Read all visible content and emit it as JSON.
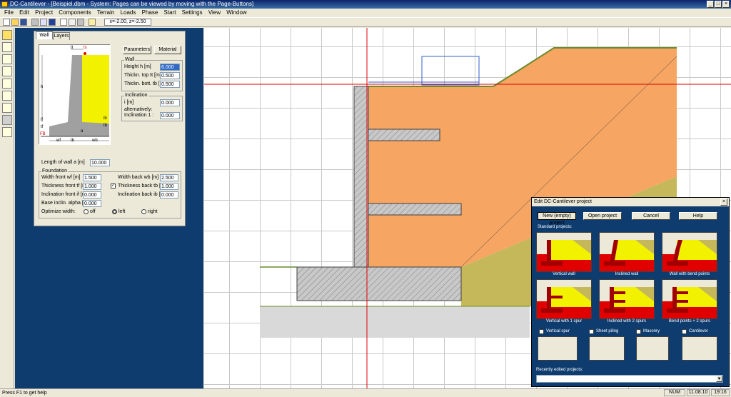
{
  "window": {
    "title": "DC-Cantilever - [Beispiel.dbm - System: Pages can be viewed by moving with the Page-Buttons]",
    "minimize": "_",
    "maximize": "□",
    "close": "×"
  },
  "menu": [
    "File",
    "Edit",
    "Project",
    "Components",
    "Terrain",
    "Loads",
    "Phase",
    "Start",
    "Settings",
    "View",
    "Window"
  ],
  "coords": "x=-2.00, z=-2.50",
  "tabs": {
    "wall": "Wall",
    "layers": "Layers"
  },
  "buttons": {
    "parameters": "Parameters",
    "material": "Material"
  },
  "wall_group": {
    "title": "Wall",
    "height_label": "Height h [m]",
    "height": "6.000",
    "top_label": "Thickn. top tt [m]",
    "top": "0.500",
    "bottom_label": "Thickn. bott. tb [m]",
    "bottom": "0.500"
  },
  "incl_group": {
    "title": "Inclination",
    "i_label": "i [m]",
    "i": "0.000",
    "alt_label": "alternatively:",
    "incl_label": "Inclination 1 :",
    "incl": "0.000"
  },
  "diagram_labels": {
    "h": "h",
    "tt": "tt",
    "ts": "ts",
    "wf": "wf",
    "wb": "wb",
    "tf": "tf",
    "tb": "tb",
    "tbb": "tb",
    "ifl": "if",
    "ibl": "ib",
    "alpha": "α",
    "fb": "FB"
  },
  "length": {
    "label": "Length of wall a [m]",
    "value": "10.000"
  },
  "foundation": {
    "title": "Foundation",
    "wf_label": "Width front wf [m]",
    "wf": "1.500",
    "tf_label": "Thickness front tf [m]",
    "tf": "1.000",
    "if_label": "Inclination front if [m]",
    "if": "0.000",
    "alpha_label": "Base inclin. alpha [°]",
    "alpha": "0.000",
    "wb_label": "Width back wb [m]",
    "wb": "2.500",
    "tb_label": "Thickness back tb [m]",
    "tb": "1.000",
    "ib_label": "Inclination back ib [m]",
    "ib": "0.000",
    "opt_label": "Optimize width:",
    "opt_off": "off",
    "opt_left": "left",
    "opt_right": "right"
  },
  "dialog": {
    "title": "Edit DC-Cantilever project",
    "close": "×",
    "new": "New (empty) project",
    "open": "Open project",
    "cancel": "Cancel",
    "help": "Help",
    "standard": "Standard projects:",
    "projects": [
      "Vertical wall",
      "Inclined wall",
      "Wall with bend points",
      "Vertical with 1 spur",
      "Inclined with 2 spurs",
      "Bend points + 2 spurs"
    ],
    "checks": [
      "Vertical spur",
      "Sheet piling",
      "Masonry",
      "Cantilever"
    ],
    "recent": "Recently edited projects:",
    "dropdown_arrow": "▼"
  },
  "status": {
    "help": "Press F1 to get help",
    "num": "NUM",
    "date": "11.08.10",
    "time": "19:16"
  },
  "colors": {
    "soil": "#f6a562",
    "backfill": "#c5b85a",
    "concrete": "#c8c8c8",
    "sky": "#ffffff",
    "navy": "#0e3c6e",
    "ground": "#d9d9d9"
  }
}
